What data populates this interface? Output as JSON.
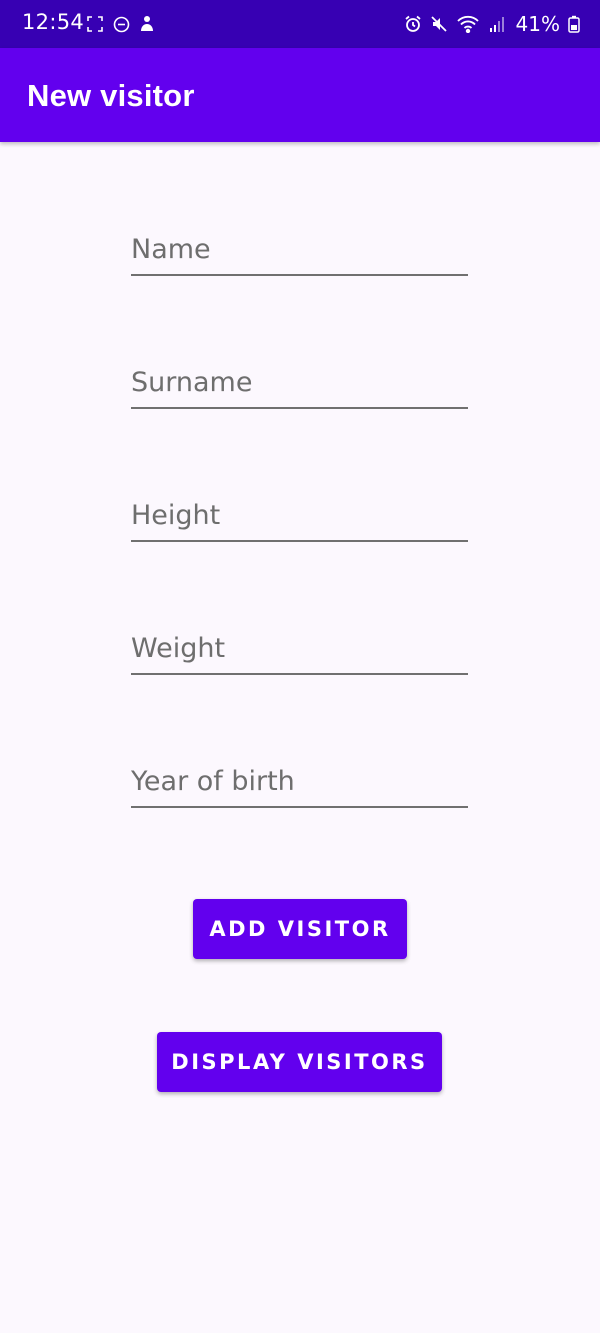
{
  "status_bar": {
    "time": "12:54",
    "battery": "41%",
    "icons_left": [
      "screenshot-icon",
      "dnd-icon",
      "notification-app-icon"
    ],
    "icons_right": [
      "alarm-icon",
      "mute-icon",
      "wifi-icon",
      "signal-icon",
      "battery-icon"
    ]
  },
  "app_bar": {
    "title": "New visitor",
    "color": "#6200ee"
  },
  "form": {
    "name_placeholder": "Name",
    "surname_placeholder": "Surname",
    "height_placeholder": "Height",
    "weight_placeholder": "Weight",
    "year_placeholder": "Year of birth"
  },
  "buttons": {
    "add_label": "ADD VISITOR",
    "display_label": "DISPLAY VISITORS"
  },
  "colors": {
    "primary": "#6200ee",
    "status_bar": "#3700b3",
    "background": "#fcf8fe"
  }
}
